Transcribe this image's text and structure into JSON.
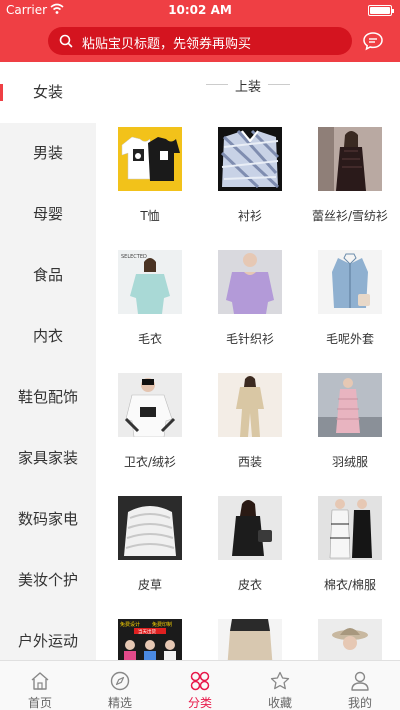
{
  "status_bar": {
    "carrier": "Carrier",
    "time": "10:02 AM"
  },
  "search": {
    "placeholder": "粘贴宝贝标题，先领券再购买",
    "icon": "search-icon"
  },
  "header": {
    "message_icon": "message-icon"
  },
  "colors": {
    "header": "#ef3f44",
    "search_bg": "#d4141f",
    "accent": "#e8194a"
  },
  "sidebar": {
    "items": [
      {
        "label": "女装",
        "active": true
      },
      {
        "label": "男装"
      },
      {
        "label": "母婴"
      },
      {
        "label": "食品"
      },
      {
        "label": "内衣"
      },
      {
        "label": "鞋包配饰"
      },
      {
        "label": "家具家装"
      },
      {
        "label": "数码家电"
      },
      {
        "label": "美妆个护"
      },
      {
        "label": "户外运动"
      }
    ]
  },
  "content": {
    "section_title": "上装",
    "items": [
      {
        "label": "T恤"
      },
      {
        "label": "衬衫"
      },
      {
        "label": "蕾丝衫/雪纺衫"
      },
      {
        "label": "毛衣"
      },
      {
        "label": "毛针织衫"
      },
      {
        "label": "毛呢外套"
      },
      {
        "label": "卫衣/绒衫"
      },
      {
        "label": "西装"
      },
      {
        "label": "羽绒服"
      },
      {
        "label": "皮草"
      },
      {
        "label": "皮衣"
      },
      {
        "label": "棉衣/棉服"
      }
    ],
    "thumb_texts": {
      "selected": "SELECTED",
      "promo_1": "免费设计",
      "promo_2": "免费印制",
      "promo_3": "当天出货"
    }
  },
  "tabbar": {
    "tabs": [
      {
        "label": "首页",
        "icon": "home-icon"
      },
      {
        "label": "精选",
        "icon": "compass-icon"
      },
      {
        "label": "分类",
        "icon": "category-icon",
        "active": true
      },
      {
        "label": "收藏",
        "icon": "star-icon"
      },
      {
        "label": "我的",
        "icon": "user-icon"
      }
    ]
  }
}
